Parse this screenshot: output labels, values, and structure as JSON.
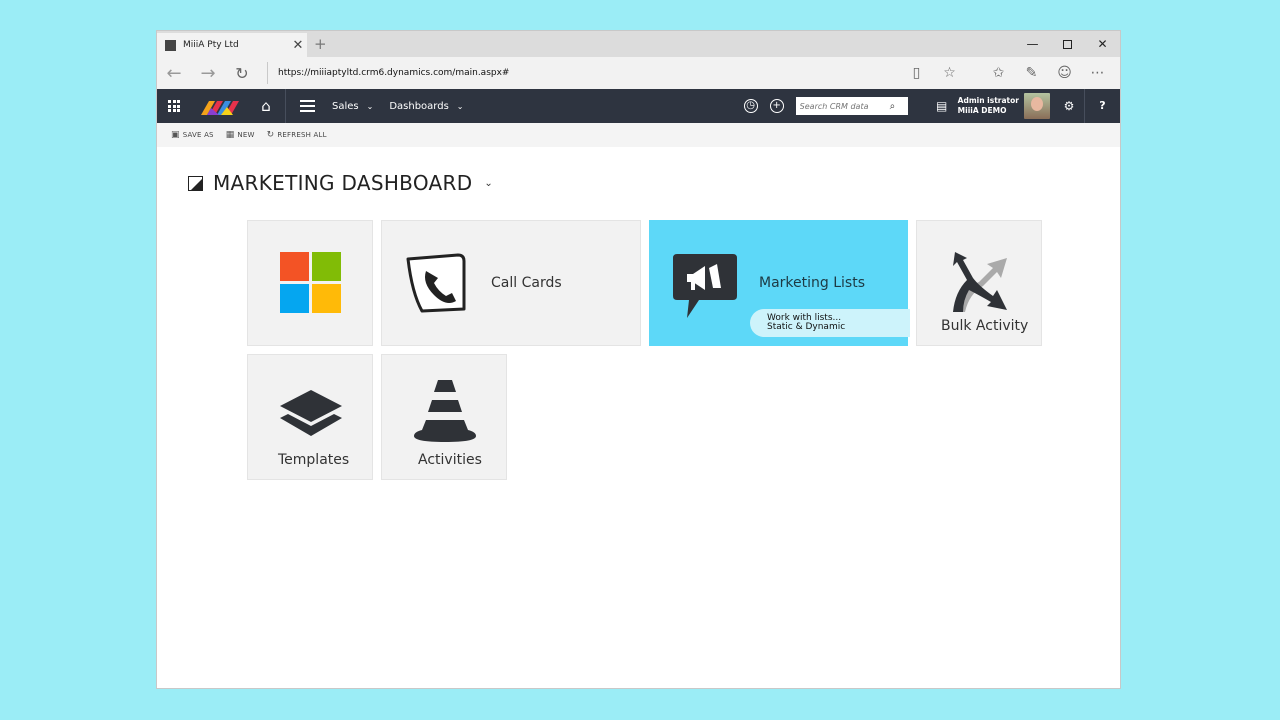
{
  "browser": {
    "tab_title": "MiiiA Pty Ltd",
    "tab_close": "✕",
    "new_tab": "+",
    "url": "https://miiiaptyltd.crm6.dynamics.com/main.aspx#",
    "minimize": "—",
    "close": "✕"
  },
  "crm_nav": {
    "items": [
      {
        "label": "Sales"
      },
      {
        "label": "Dashboards"
      }
    ],
    "search_placeholder": "Search CRM data",
    "user_name": "Admin istrator",
    "user_org": "MiiiA DEMO",
    "help": "?"
  },
  "commands": [
    {
      "label": "SAVE AS"
    },
    {
      "label": "NEW"
    },
    {
      "label": "REFRESH ALL"
    }
  ],
  "dashboard": {
    "title": "MARKETING DASHBOARD"
  },
  "tiles": {
    "call_cards": "Call Cards",
    "marketing_lists": "Marketing Lists",
    "marketing_lists_sub1": "Work with lists...",
    "marketing_lists_sub2": "Static & Dynamic",
    "bulk_activity": "Bulk Activity",
    "templates": "Templates",
    "activities": "Activities"
  },
  "colors": {
    "nav_bg": "#2e3440",
    "accent_tile": "#5dd8f8",
    "ms_red": "#f35325",
    "ms_green": "#81bc06",
    "ms_blue": "#05a6f0",
    "ms_yellow": "#ffba08"
  }
}
